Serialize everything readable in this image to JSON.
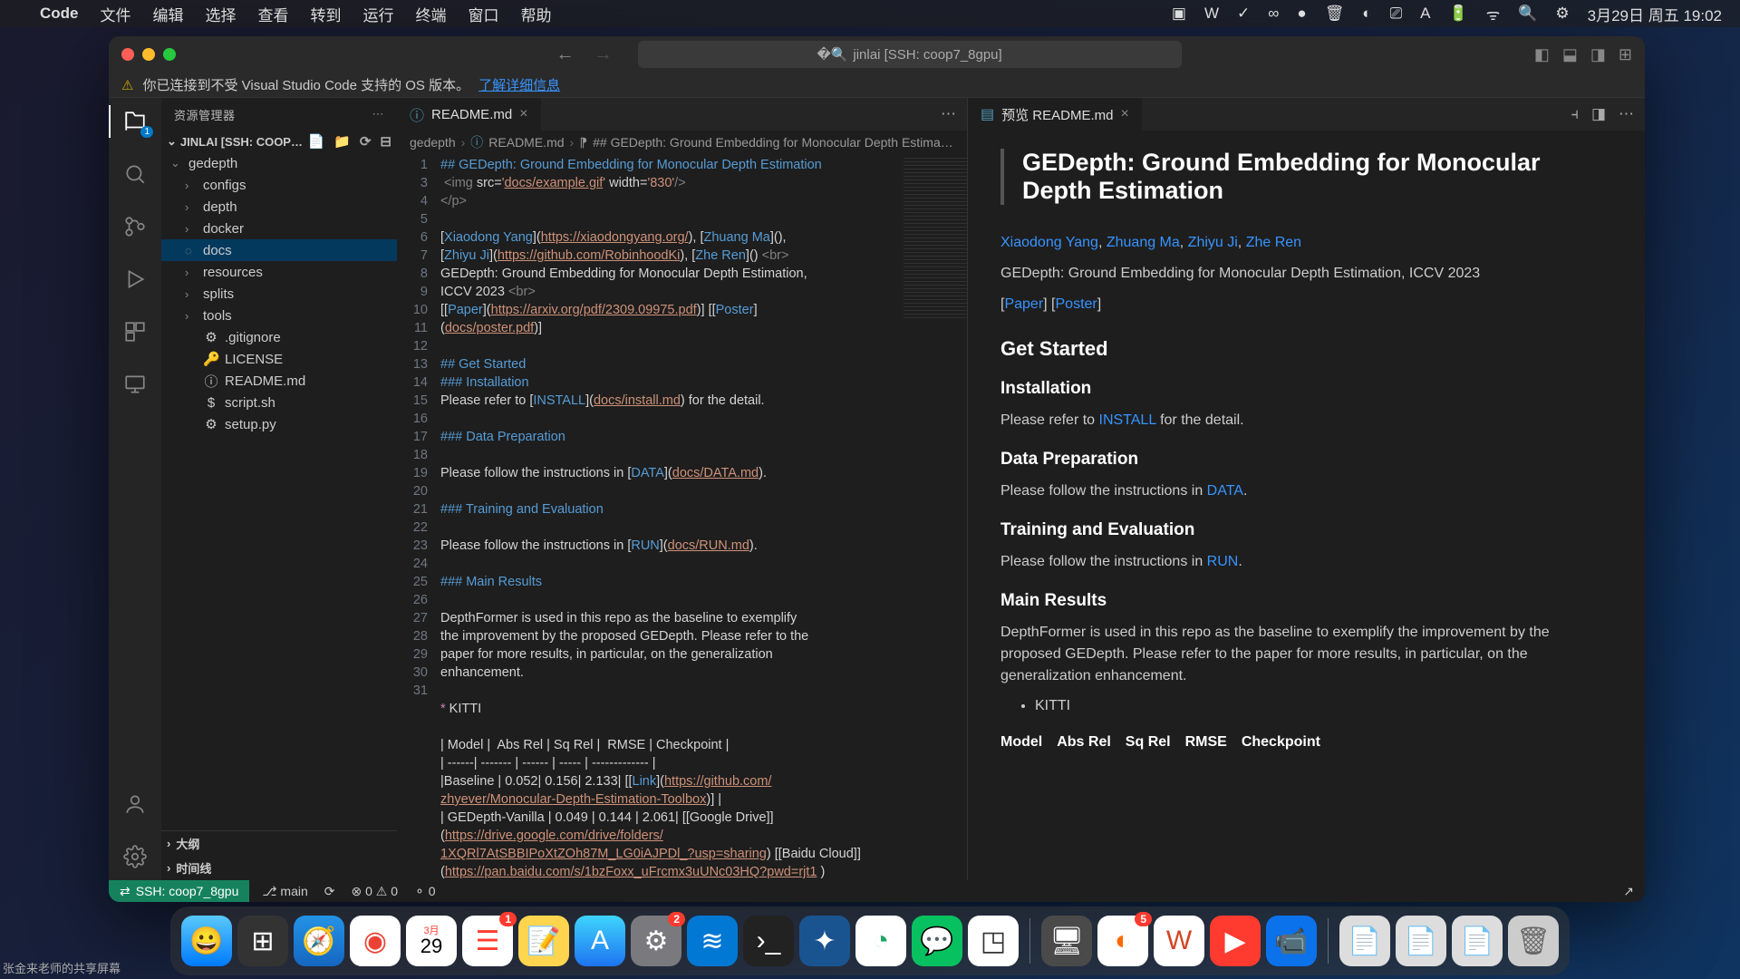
{
  "menubar": {
    "app": "Code",
    "items": [
      "文件",
      "编辑",
      "选择",
      "查看",
      "转到",
      "运行",
      "终端",
      "窗口",
      "帮助"
    ],
    "battery": "",
    "datetime": "3月29日 周五 19:02"
  },
  "titlebar": {
    "search_text": "jinlai [SSH: coop7_8gpu]"
  },
  "warning": {
    "text": "你已连接到不受 Visual Studio Code 支持的 OS 版本。",
    "link": "了解详细信息"
  },
  "sidebar": {
    "title": "资源管理器",
    "root": "JINLAI [SSH: COOP7_...",
    "tree": [
      {
        "label": "gedepth",
        "type": "folder",
        "depth": 0,
        "expanded": true
      },
      {
        "label": "configs",
        "type": "folder",
        "depth": 1
      },
      {
        "label": "depth",
        "type": "folder",
        "depth": 1
      },
      {
        "label": "docker",
        "type": "folder",
        "depth": 1
      },
      {
        "label": "docs",
        "type": "folder",
        "depth": 1,
        "selected": true,
        "loading": true
      },
      {
        "label": "resources",
        "type": "folder",
        "depth": 1
      },
      {
        "label": "splits",
        "type": "folder",
        "depth": 1
      },
      {
        "label": "tools",
        "type": "folder",
        "depth": 1
      },
      {
        "label": ".gitignore",
        "type": "file",
        "depth": 1,
        "icon": "⚙"
      },
      {
        "label": "LICENSE",
        "type": "file",
        "depth": 1,
        "icon": "🔑"
      },
      {
        "label": "README.md",
        "type": "file",
        "depth": 1,
        "icon": "ⓘ"
      },
      {
        "label": "script.sh",
        "type": "file",
        "depth": 1,
        "icon": "$"
      },
      {
        "label": "setup.py",
        "type": "file",
        "depth": 1,
        "icon": "⚙"
      }
    ],
    "sections": [
      "大纲",
      "时间线"
    ]
  },
  "editor": {
    "tab_label": "README.md",
    "breadcrumb": [
      "gedepth",
      "README.md",
      "## GEDepth: Ground Embedding for Monocular Depth Estimation"
    ],
    "lines": [
      "1",
      "3",
      "4",
      "5",
      "6",
      "",
      "7",
      "",
      "8",
      "",
      "9",
      "10",
      "11",
      "12",
      "13",
      "14",
      "15",
      "16",
      "17",
      "18",
      "19",
      "20",
      "21",
      "22",
      "23",
      "24",
      "",
      "",
      "",
      "25",
      "26",
      "27",
      "28",
      "29",
      "30",
      "",
      "31",
      "",
      "",
      ""
    ]
  },
  "preview": {
    "tab_label": "预览 README.md",
    "title": "GEDepth: Ground Embedding for Monocular Depth Estimation",
    "authors": [
      "Xiaodong Yang",
      "Zhuang Ma",
      "Zhiyu Ji",
      "Zhe Ren"
    ],
    "citation": "GEDepth: Ground Embedding for Monocular Depth Estimation, ICCV 2023",
    "paper_label": "Paper",
    "poster_label": "Poster",
    "h_get_started": "Get Started",
    "h_installation": "Installation",
    "p_install_pre": "Please refer to ",
    "p_install_link": "INSTALL",
    "p_install_post": " for the detail.",
    "h_data_prep": "Data Preparation",
    "p_data_pre": "Please follow the instructions in ",
    "p_data_link": "DATA",
    "h_train": "Training and Evaluation",
    "p_train_pre": "Please follow the instructions in ",
    "p_train_link": "RUN",
    "h_results": "Main Results",
    "p_results": "DepthFormer is used in this repo as the baseline to exemplify the improvement by the proposed GEDepth. Please refer to the paper for more results, in particular, on the generalization enhancement.",
    "li_kitti": "KITTI",
    "table_headers": [
      "Model",
      "Abs Rel",
      "Sq Rel",
      "RMSE",
      "Checkpoint"
    ]
  },
  "statusbar": {
    "remote": "SSH: coop7_8gpu",
    "branch": "main",
    "errors": "0",
    "warnings": "0",
    "ports": "0"
  },
  "share_indicator": "张金来老师的共享屏幕"
}
